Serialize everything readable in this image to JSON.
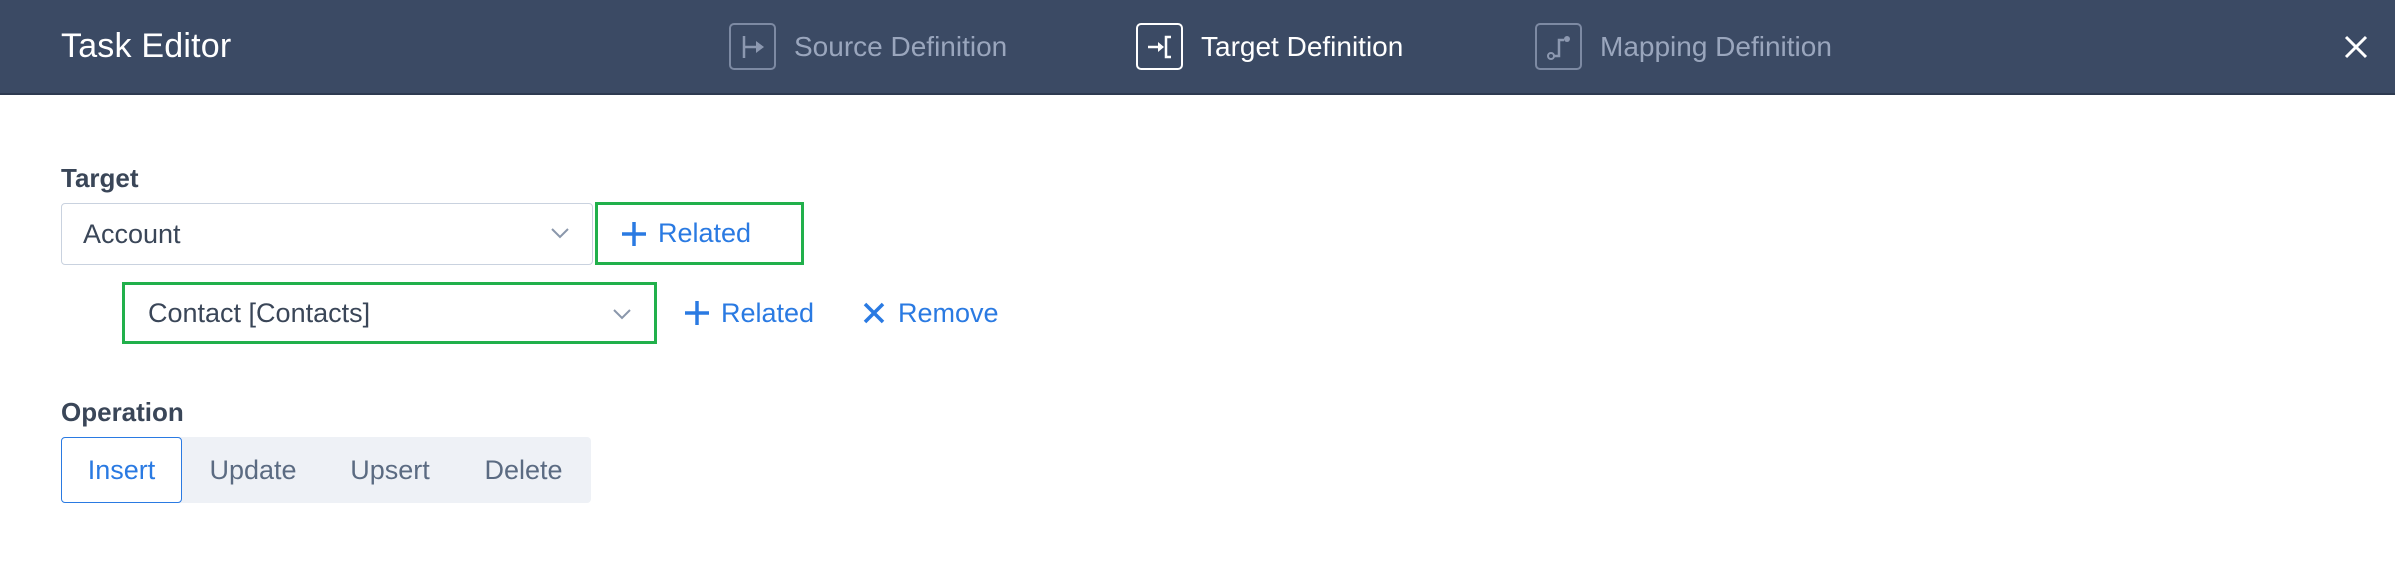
{
  "header": {
    "title": "Task Editor",
    "steps": [
      {
        "label": "Source Definition",
        "icon": "source-definition-icon",
        "active": false
      },
      {
        "label": "Target Definition",
        "icon": "target-definition-icon",
        "active": true
      },
      {
        "label": "Mapping Definition",
        "icon": "mapping-definition-icon",
        "active": false
      }
    ],
    "close_icon": "close-icon"
  },
  "target": {
    "label": "Target",
    "primary_object": "Account",
    "related_button": "Related",
    "related_object": "Contact [Contacts]",
    "nested_related_button": "Related",
    "remove_button": "Remove"
  },
  "operation": {
    "label": "Operation",
    "options": [
      "Insert",
      "Update",
      "Upsert",
      "Delete"
    ],
    "selected": "Insert"
  },
  "colors": {
    "header_bg": "#3b4a64",
    "accent": "#2a7ae2",
    "highlight": "#21b04b"
  }
}
